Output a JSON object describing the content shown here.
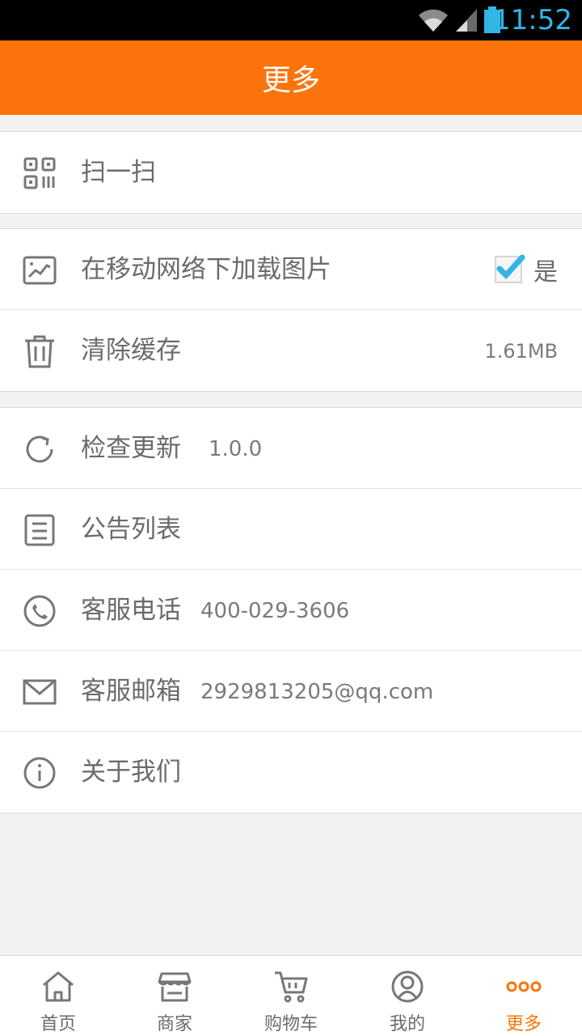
{
  "status_bar": {
    "time": "11:52",
    "colors": {
      "time": "#33b5e5"
    }
  },
  "header": {
    "title": "更多",
    "background": "#fb740b"
  },
  "menu": {
    "scan": {
      "label": "扫一扫",
      "icon": "qr-code-icon"
    },
    "load_images": {
      "label": "在移动网络下加载图片",
      "icon": "image-icon",
      "checked": true,
      "checkbox_label": "是"
    },
    "clear_cache": {
      "label": "清除缓存",
      "icon": "trash-icon",
      "value": "1.61MB"
    },
    "check_update": {
      "label": "检查更新",
      "icon": "refresh-icon",
      "value": "1.0.0"
    },
    "notices": {
      "label": "公告列表",
      "icon": "document-icon"
    },
    "phone": {
      "label": "客服电话",
      "icon": "phone-icon",
      "value": "400-029-3606"
    },
    "email": {
      "label": "客服邮箱",
      "icon": "mail-icon",
      "value": "2929813205@qq.com"
    },
    "about": {
      "label": "关于我们",
      "icon": "info-icon"
    }
  },
  "tabbar": {
    "items": [
      {
        "label": "首页",
        "icon": "home-icon"
      },
      {
        "label": "商家",
        "icon": "store-icon"
      },
      {
        "label": "购物车",
        "icon": "cart-icon"
      },
      {
        "label": "我的",
        "icon": "user-icon"
      },
      {
        "label": "更多",
        "icon": "more-icon",
        "active": true
      }
    ],
    "active_color": "#fb740b"
  }
}
